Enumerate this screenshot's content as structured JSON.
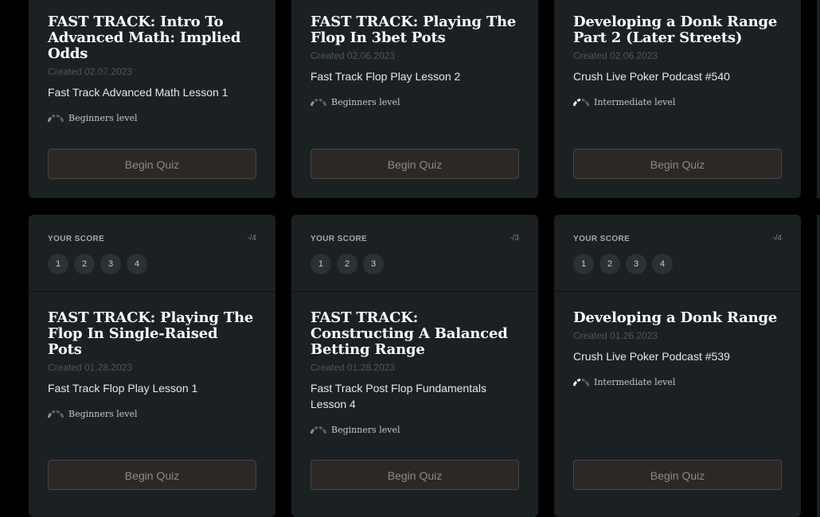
{
  "ui": {
    "begin_quiz": "Begin Quiz",
    "your_score": "YOUR SCORE"
  },
  "cards": [
    {
      "title": "FAST TRACK: Intro To Advanced Math: Implied Odds",
      "created": "Created 02.07.2023",
      "subtitle": "Fast Track Advanced Math Lesson 1",
      "level": "Beginners level"
    },
    {
      "title": "FAST TRACK: Playing The Flop In 3bet Pots",
      "created": "Created 02.06.2023",
      "subtitle": "Fast Track Flop Play Lesson 2",
      "level": "Beginners level"
    },
    {
      "title": "Developing a Donk Range Part 2 (Later Streets)",
      "created": "Created 02.06.2023",
      "subtitle": "Crush Live Poker Podcast #540",
      "level": "Intermediate level"
    },
    {
      "score": "-/4",
      "questions": [
        "1",
        "2",
        "3",
        "4"
      ],
      "title": "FAST TRACK: Playing The Flop In Single-Raised Pots",
      "created": "Created 01.28.2023",
      "subtitle": "Fast Track Flop Play Lesson 1",
      "level": "Beginners level"
    },
    {
      "score": "-/3",
      "questions": [
        "1",
        "2",
        "3"
      ],
      "title": "FAST TRACK: Constructing A Balanced Betting Range",
      "created": "Created 01.28.2023",
      "subtitle": "Fast Track Post Flop Fundamentals Lesson 4",
      "level": "Beginners level"
    },
    {
      "score": "-/4",
      "questions": [
        "1",
        "2",
        "3",
        "4"
      ],
      "title": "Developing a Donk Range",
      "created": "Created 01.26.2023",
      "subtitle": "Crush Live Poker Podcast #539",
      "level": "Intermediate level"
    }
  ]
}
